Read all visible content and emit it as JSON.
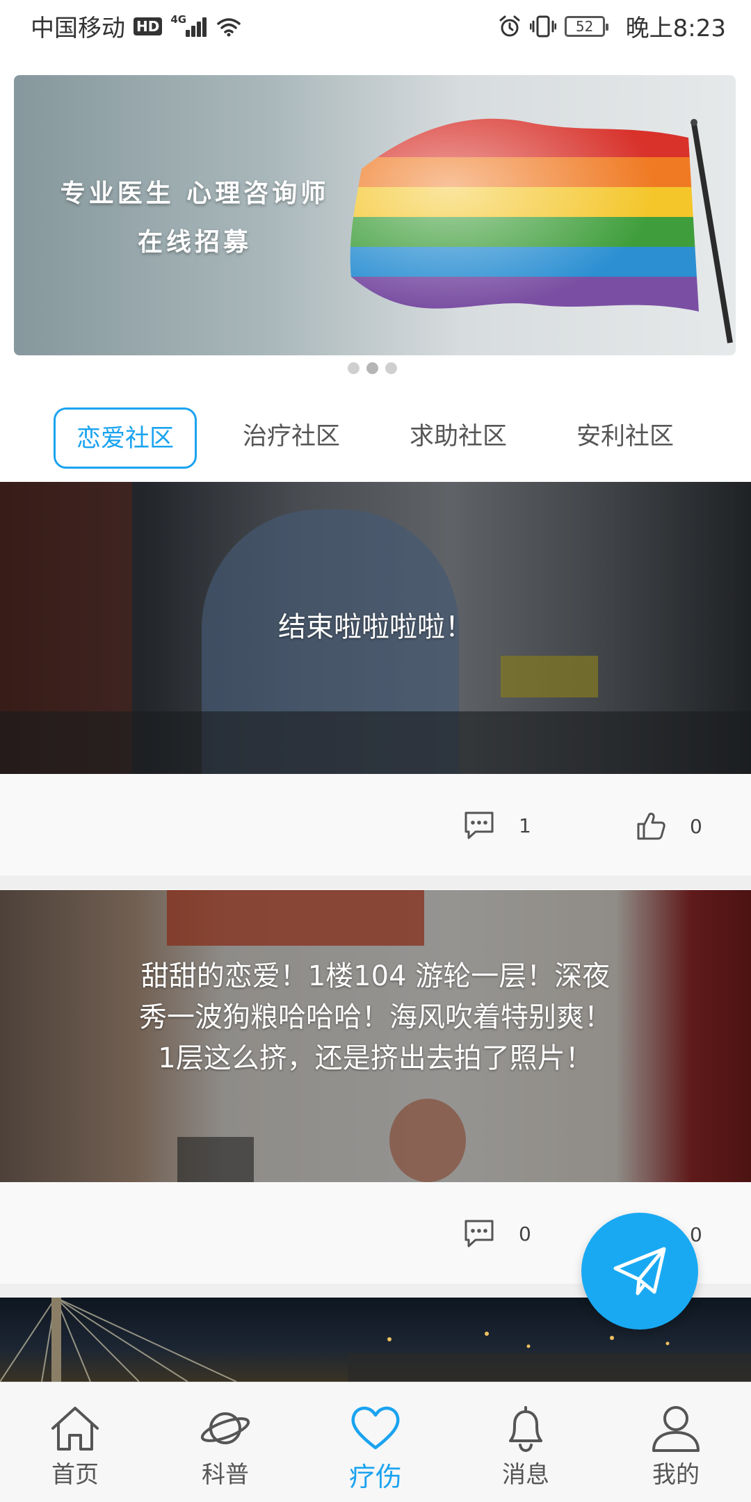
{
  "status_bar": {
    "carrier": "中国移动",
    "hd": "HD",
    "network": "4G",
    "battery": "52",
    "time": "晚上8:23"
  },
  "banner": {
    "line1": "专业医生 心理咨询师",
    "line2": "在线招募",
    "page_indicator": {
      "count": 3,
      "active_index": 1
    }
  },
  "tabs": [
    {
      "label": "恋爱社区",
      "active": true
    },
    {
      "label": "治疗社区",
      "active": false
    },
    {
      "label": "求助社区",
      "active": false
    },
    {
      "label": "安利社区",
      "active": false
    }
  ],
  "posts": [
    {
      "title": "结束啦啦啦啦！",
      "comments": "1",
      "likes": "0"
    },
    {
      "title": "甜甜的恋爱！1楼104 游轮一层！深夜秀一波狗粮哈哈哈！海风吹着特别爽！1层这么挤，还是挤出去拍了照片！",
      "comments": "0",
      "likes": "0"
    }
  ],
  "bottom_nav": [
    {
      "label": "首页",
      "icon": "home-icon",
      "active": false
    },
    {
      "label": "科普",
      "icon": "planet-icon",
      "active": false
    },
    {
      "label": "疗伤",
      "icon": "heart-icon",
      "active": true
    },
    {
      "label": "消息",
      "icon": "bell-icon",
      "active": false
    },
    {
      "label": "我的",
      "icon": "user-icon",
      "active": false
    }
  ],
  "colors": {
    "accent": "#1aa3f0",
    "fab": "#19a9f3",
    "text": "#333333"
  }
}
